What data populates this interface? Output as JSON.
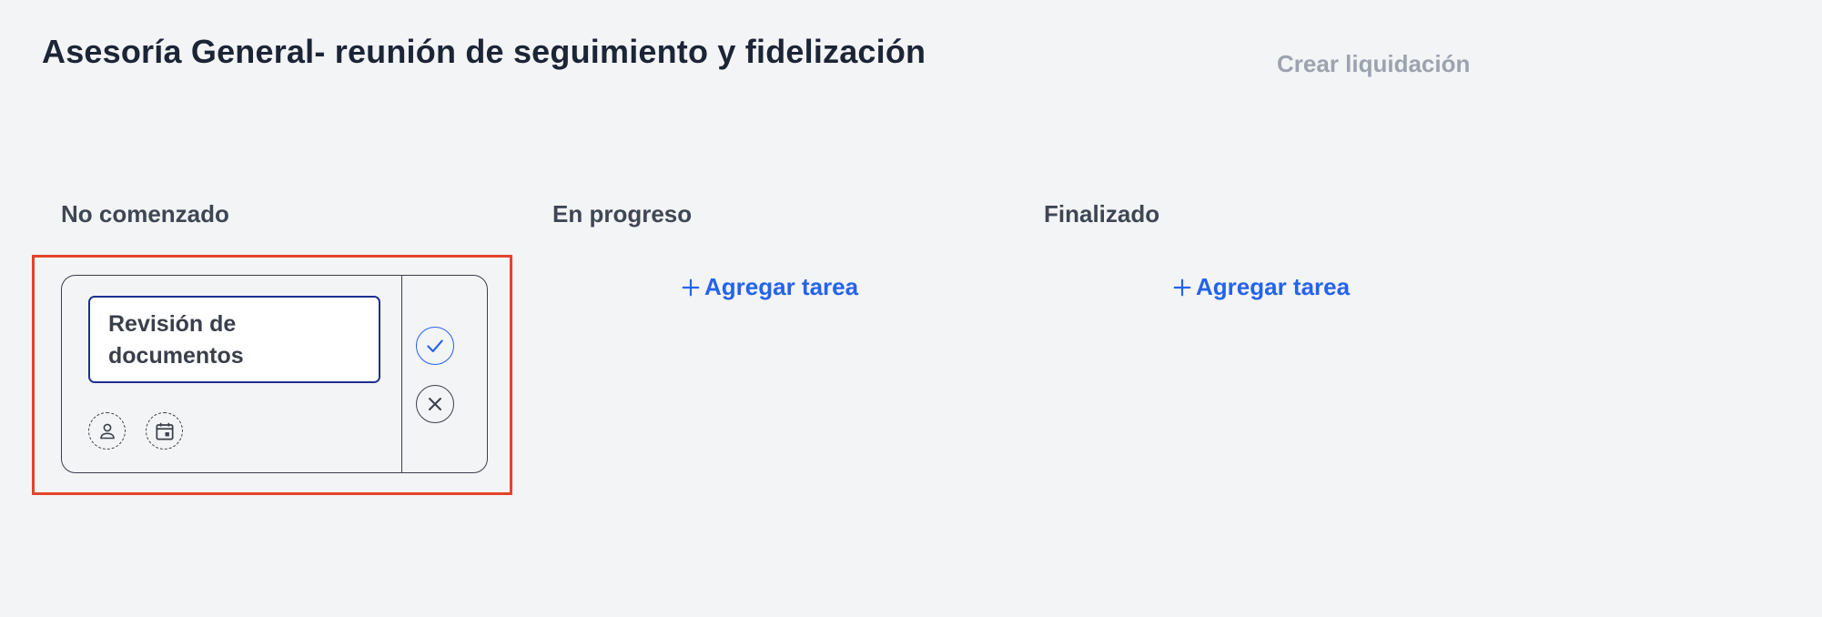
{
  "header": {
    "title": "Asesoría General- reunión de seguimiento y fidelización",
    "create_settlement_label": "Crear liquidación"
  },
  "columns": [
    {
      "label": "No comenzado"
    },
    {
      "label": "En progreso",
      "add_task_label": "Agregar tarea"
    },
    {
      "label": "Finalizado",
      "add_task_label": "Agregar tarea"
    }
  ],
  "task_editor": {
    "input_value": "Revisión de documentos",
    "icons": {
      "assign": "user-icon",
      "date": "calendar-icon",
      "confirm": "check-icon",
      "cancel": "close-icon",
      "add": "plus-icon"
    }
  },
  "colors": {
    "accent": "#2563eb",
    "input_border": "#1e2f8f",
    "highlight": "#e5432b",
    "background": "#f3f4f6",
    "muted_text": "#9ca3af"
  }
}
